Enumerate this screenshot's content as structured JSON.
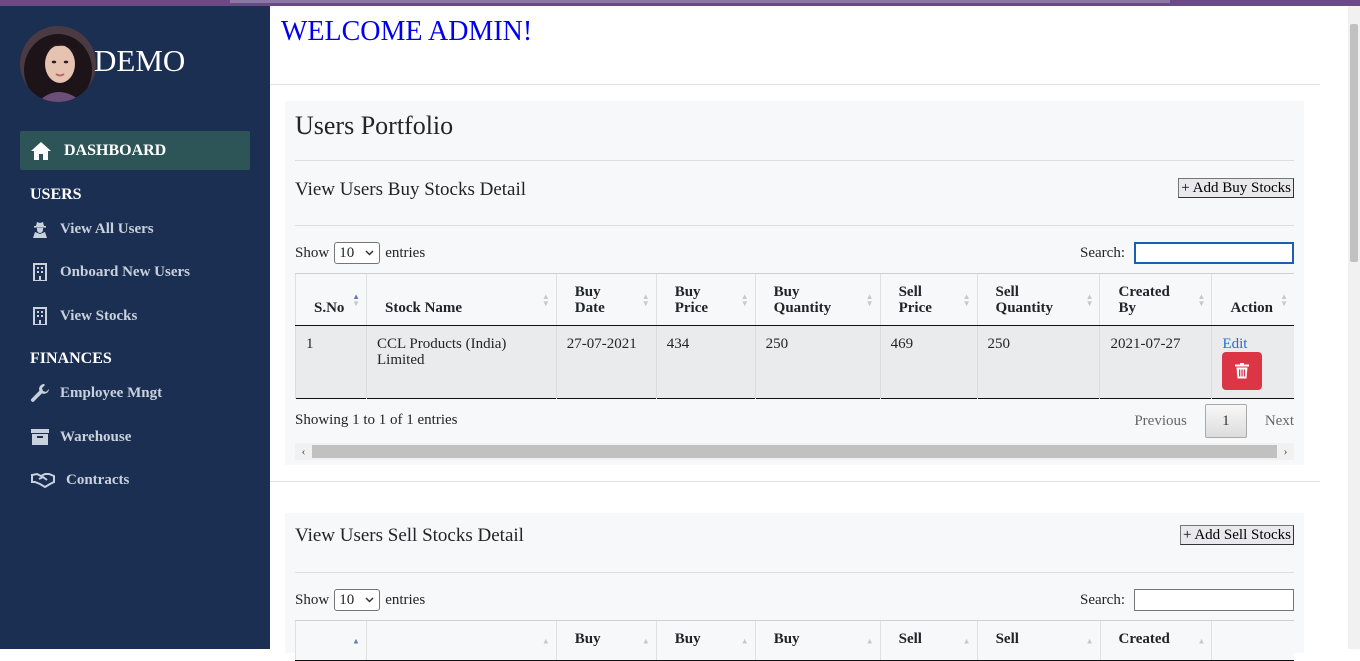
{
  "sidebar": {
    "brand": "DEMO",
    "active_item": "DASHBOARD",
    "sections": [
      "USERS",
      "FINANCES"
    ],
    "items": [
      {
        "label": "View All Users",
        "icon": "user-secret-icon"
      },
      {
        "label": "Onboard New Users",
        "icon": "building-icon"
      },
      {
        "label": "View Stocks",
        "icon": "building-icon"
      },
      {
        "label": "Employee Mngt",
        "icon": "wrench-icon"
      },
      {
        "label": "Warehouse",
        "icon": "archive-icon"
      },
      {
        "label": "Contracts",
        "icon": "handshake-icon"
      }
    ]
  },
  "main": {
    "welcome": "WELCOME ADMIN!",
    "portfolio_title": "Users Portfolio",
    "buy": {
      "title": "View Users Buy Stocks Detail",
      "add_label": "+ Add Buy Stocks",
      "show_label": "Show",
      "entries_label": "entries",
      "page_size": "10",
      "search_label": "Search:",
      "search_value": "",
      "columns": [
        "S.No",
        "Stock Name",
        "Buy Date",
        "Buy Price",
        "Buy Quantity",
        "Sell Price",
        "Sell Quantity",
        "Created By",
        "Action"
      ],
      "rows": [
        {
          "sno": "1",
          "stock": "CCL Products (India) Limited",
          "buy_date": "27-07-2021",
          "buy_price": "434",
          "buy_qty": "250",
          "sell_price": "469",
          "sell_qty": "250",
          "created_by": "2021-07-27",
          "edit": "Edit"
        }
      ],
      "info": "Showing 1 to 1 of 1 entries",
      "prev": "Previous",
      "page": "1",
      "next": "Next"
    },
    "sell": {
      "title": "View Users Sell Stocks Detail",
      "add_label": "+ Add Sell Stocks",
      "show_label": "Show",
      "entries_label": "entries",
      "page_size": "10",
      "search_label": "Search:",
      "search_value": "",
      "columns": [
        "",
        "",
        "Buy",
        "Buy",
        "Buy",
        "Sell",
        "Sell",
        "Created",
        ""
      ]
    }
  },
  "colors": {
    "sidebar_bg": "#1b2f52",
    "active_bg": "#2d5558",
    "welcome": "#0000ee",
    "delete": "#dc3545",
    "link": "#1f6fd6"
  }
}
